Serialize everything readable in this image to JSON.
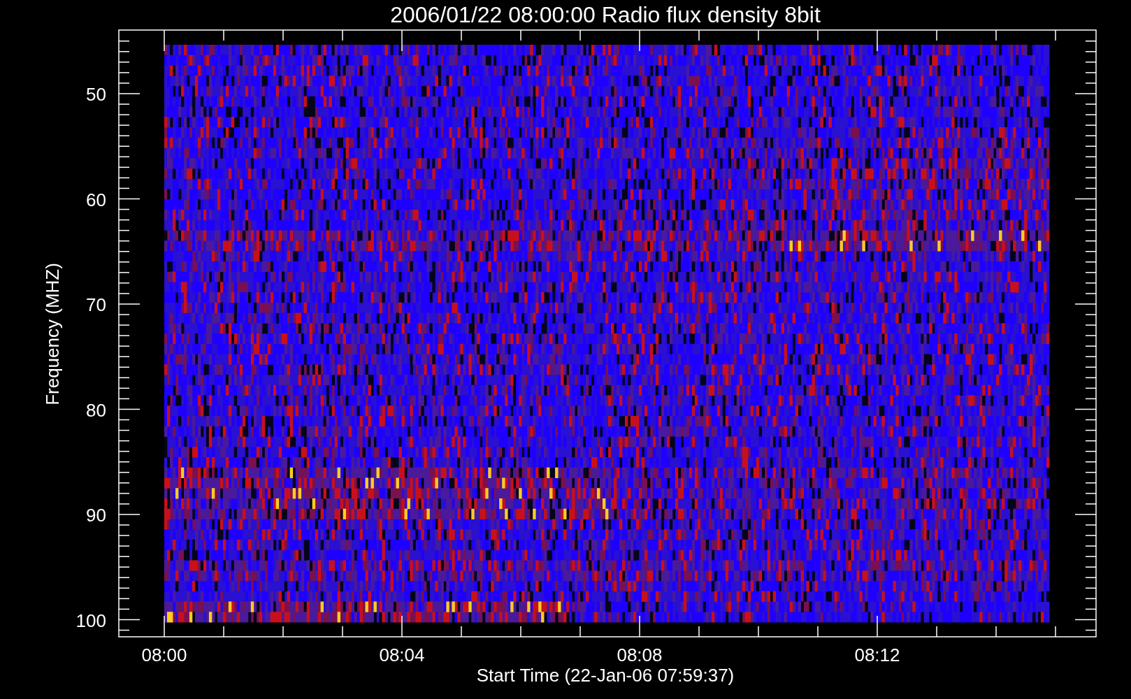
{
  "chart": {
    "title": "2006/01/22 08:00:00 Radio flux density 8bit",
    "y_axis": {
      "label": "Frequency (MHZ)",
      "ticks": [
        "50",
        "60",
        "70",
        "80",
        "90",
        "100"
      ]
    },
    "x_axis": {
      "label": "Start Time (22-Jan-06 07:59:37)",
      "ticks": [
        "08:00",
        "08:04",
        "08:08",
        "08:12"
      ]
    }
  }
}
